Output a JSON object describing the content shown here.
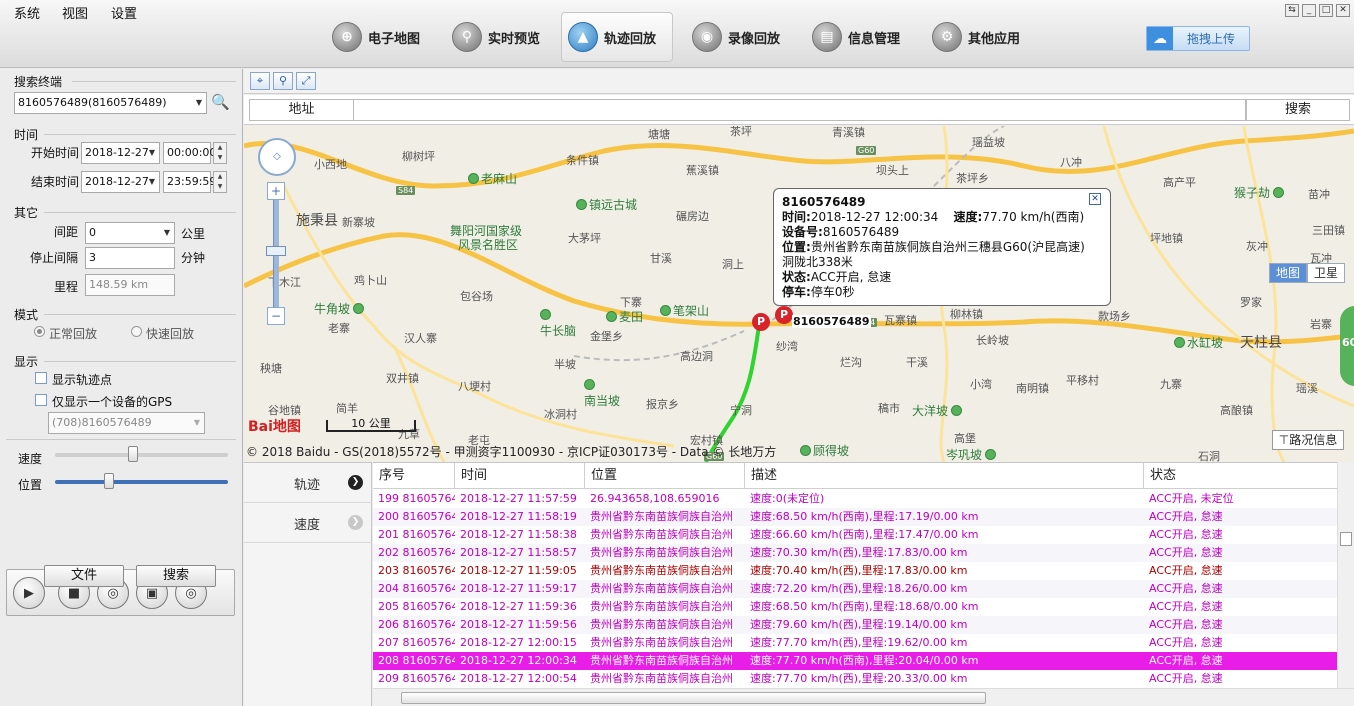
{
  "menu": [
    "系统",
    "视图",
    "设置"
  ],
  "tabs": [
    {
      "label": "电子地图",
      "icon": "map-icon"
    },
    {
      "label": "实时预览",
      "icon": "search-icon"
    },
    {
      "label": "轨迹回放",
      "icon": "car-icon",
      "active": true
    },
    {
      "label": "录像回放",
      "icon": "video-icon"
    },
    {
      "label": "信息管理",
      "icon": "server-icon"
    },
    {
      "label": "其他应用",
      "icon": "apps-icon"
    }
  ],
  "upload_label": "拖拽上传",
  "left": {
    "search_title": "搜索终端",
    "terminal": "8160576489(8160576489)",
    "time_title": "时间",
    "start_label": "开始时间",
    "start_date": "2018-12-27",
    "start_time": "00:00:00",
    "end_label": "结束时间",
    "end_date": "2018-12-27",
    "end_time": "23:59:59",
    "other_title": "其它",
    "interval_label": "间距",
    "interval_value": "0",
    "interval_unit": "公里",
    "stop_label": "停止间隔",
    "stop_value": "3",
    "stop_unit": "分钟",
    "mileage_label": "里程",
    "mileage_value": "148.59 km",
    "mode_title": "模式",
    "mode_normal": "正常回放",
    "mode_fast": "快速回放",
    "display_title": "显示",
    "show_points": "显示轨迹点",
    "show_one_gps": "仅显示一个设备的GPS",
    "device_select": "(708)8160576489",
    "speed_label": "速度",
    "position_label": "位置",
    "speed_level": 0.45,
    "position_level": 0.3,
    "file_btn": "文件",
    "search_btn": "搜索"
  },
  "address": {
    "label": "地址",
    "search": "搜索"
  },
  "map": {
    "type_map": "地图",
    "type_satellite": "卫星",
    "scale": "10 公里",
    "copyright": "© 2018 Baidu - GS(2018)5572号 - 甲测资字1100930 - 京ICP证030173号 - Data © 长地万方",
    "traffic": "路况信息",
    "logo": "Bai地图",
    "marker_label": "8160576489",
    "marker_letter": "P",
    "edge_badge": "60",
    "roads": [
      "G60",
      "S84",
      "S84",
      "G60"
    ],
    "places": {
      "p1": "小西地",
      "p2": "柳树坪",
      "p3": "条件镇",
      "p4": "塘塘",
      "p5": "茶坪",
      "p6": "青溪镇",
      "p7": "瑶益坡",
      "p8": "八冲",
      "p9": "施秉县",
      "p10": "老麻山",
      "p11": "镇远古城",
      "p12": "蕉溪镇",
      "p13": "坝头上",
      "p14": "茶坪乡",
      "p15": "高产平",
      "p16": "猴子劫",
      "p17": "苗冲",
      "p18": "新寨坡",
      "p19": "舞阳河国家级",
      "p20": "风景名胜区",
      "p21": "大茅坪",
      "p22": "碾房边",
      "p23": "坪地镇",
      "p24": "三田镇",
      "p25": "鸡卜山",
      "p26": "甘溪",
      "p27": "洞上",
      "p28": "灰冲",
      "p29": "瓦冲",
      "p30": "牛角坡",
      "p31": "包谷场",
      "p32": "下寨",
      "p33": "笔架山",
      "p34": "老寨",
      "p35": "汉人寨",
      "p36": "牛长脑",
      "p37": "麦田",
      "p38": "金堡乡",
      "p39": "柳林镇",
      "p40": "款场乡",
      "p41": "罗家",
      "p42": "水缸坡",
      "p43": "天柱县",
      "p44": "岩寨",
      "p45": "秧塘",
      "p46": "纱湾",
      "p47": "瓦寨镇",
      "p48": "长岭坡",
      "p49": "高边洞",
      "p50": "半坡",
      "p51": "烂沟",
      "p52": "干溪",
      "p53": "双井镇",
      "p54": "八埂村",
      "p55": "小湾",
      "p56": "南明镇",
      "p57": "平移村",
      "p58": "九寨",
      "p59": "瑶溪",
      "p60": "谷地镇",
      "p61": "简羊",
      "p62": "南当坡",
      "p63": "冰洞村",
      "p64": "报京乡",
      "p65": "稿市",
      "p66": "大洋坡",
      "p67": "高堡",
      "p68": "高酿镇",
      "p69": "九草",
      "p70": "老屯",
      "p71": "宏村镇",
      "p72": "顾得坡",
      "p73": "岑巩坡",
      "p74": "石洞",
      "p75": "下木江",
      "p76": "宁洞"
    }
  },
  "popup": {
    "title": "8160576489",
    "time_label": "时间:",
    "time_value": "2018-12-27 12:00:34",
    "speed_label": "速度:",
    "speed_value": "77.70 km/h(西南)",
    "device_label": "设备号:",
    "device_value": "8160576489",
    "pos_label": "位置:",
    "pos_value": "贵州省黔东南苗族侗族自治州三穗县G60(沪昆高速)",
    "pos_value2": "洞陇北338米",
    "status_label": "状态:",
    "status_value": "ACC开启, 怠速",
    "stop_label": "停车:",
    "stop_value": "停车0秒"
  },
  "side_tabs": [
    {
      "label": "轨迹"
    },
    {
      "label": "速度"
    }
  ],
  "table": {
    "headers": [
      "序号",
      "时间",
      "位置",
      "描述",
      "状态"
    ],
    "rows": [
      {
        "no": "199 8160576489",
        "time": "2018-12-27 11:57:59",
        "pos": "26.943658,108.659016",
        "desc": "速度:0(未定位)",
        "status": "ACC开启, 未定位",
        "color": "#c000c0"
      },
      {
        "no": "200 8160576489",
        "time": "2018-12-27 11:58:19",
        "pos": "贵州省黔东南苗族侗族自治州",
        "desc": "速度:68.50 km/h(西南),里程:17.19/0.00 km",
        "status": "ACC开启, 怠速",
        "color": "#c000c0"
      },
      {
        "no": "201 8160576489",
        "time": "2018-12-27 11:58:38",
        "pos": "贵州省黔东南苗族侗族自治州",
        "desc": "速度:66.60 km/h(西南),里程:17.47/0.00 km",
        "status": "ACC开启, 怠速",
        "color": "#c000c0"
      },
      {
        "no": "202 8160576489",
        "time": "2018-12-27 11:58:57",
        "pos": "贵州省黔东南苗族侗族自治州",
        "desc": "速度:70.30 km/h(西),里程:17.83/0.00 km",
        "status": "ACC开启, 怠速",
        "color": "#c000c0"
      },
      {
        "no": "203 8160576489",
        "time": "2018-12-27 11:59:05",
        "pos": "贵州省黔东南苗族侗族自治州",
        "desc": "速度:70.40 km/h(西),里程:17.83/0.00 km",
        "status": "ACC开启, 怠速",
        "color": "#b00000"
      },
      {
        "no": "204 8160576489",
        "time": "2018-12-27 11:59:17",
        "pos": "贵州省黔东南苗族侗族自治州",
        "desc": "速度:72.20 km/h(西),里程:18.26/0.00 km",
        "status": "ACC开启, 怠速",
        "color": "#c000c0"
      },
      {
        "no": "205 8160576489",
        "time": "2018-12-27 11:59:36",
        "pos": "贵州省黔东南苗族侗族自治州",
        "desc": "速度:68.50 km/h(西南),里程:18.68/0.00 km",
        "status": "ACC开启, 怠速",
        "color": "#c000c0"
      },
      {
        "no": "206 8160576489",
        "time": "2018-12-27 11:59:56",
        "pos": "贵州省黔东南苗族侗族自治州",
        "desc": "速度:79.60 km/h(西),里程:19.14/0.00 km",
        "status": "ACC开启, 怠速",
        "color": "#c000c0"
      },
      {
        "no": "207 8160576489",
        "time": "2018-12-27 12:00:15",
        "pos": "贵州省黔东南苗族侗族自治州",
        "desc": "速度:77.70 km/h(西),里程:19.62/0.00 km",
        "status": "ACC开启, 怠速",
        "color": "#c000c0"
      },
      {
        "no": "208 8160576489",
        "time": "2018-12-27 12:00:34",
        "pos": "贵州省黔东南苗族侗族自治州",
        "desc": "速度:77.70 km/h(西南),里程:20.04/0.00 km",
        "status": "ACC开启, 怠速",
        "color": "#ffffff",
        "selected": true
      },
      {
        "no": "209 8160576489",
        "time": "2018-12-27 12:00:54",
        "pos": "贵州省黔东南苗族侗族自治州",
        "desc": "速度:77.70 km/h(西),里程:20.33/0.00 km",
        "status": "ACC开启, 怠速",
        "color": "#c000c0"
      }
    ]
  },
  "colors": {
    "selected_row": "#e81de8",
    "accent": "#3f8fe0",
    "track": "#2fd42f"
  }
}
